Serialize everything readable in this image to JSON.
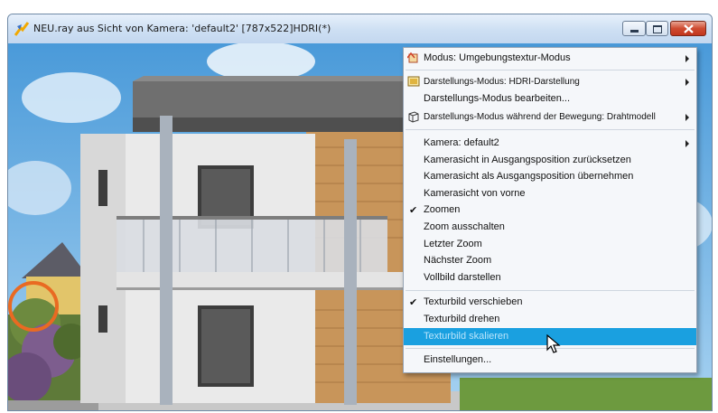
{
  "window": {
    "title": "NEU.ray aus Sicht von Kamera: 'default2' [787x522]HDRI(*)",
    "controls": [
      "minimize",
      "maximize",
      "close"
    ]
  },
  "context_menu": {
    "items": [
      {
        "label": "Modus:  Umgebungstextur-Modus",
        "icon": "texture-mode-icon",
        "submenu": true
      },
      {
        "label": "Darstellungs-Modus: HDRI-Darstellung",
        "icon": "render-mode-icon",
        "submenu": true
      },
      {
        "label": "Darstellungs-Modus bearbeiten...",
        "submenu": false
      },
      {
        "label": "Darstellungs-Modus während der Bewegung: Drahtmodell",
        "icon": "wireframe-icon",
        "submenu": true
      },
      {
        "label": "Kamera: default2",
        "submenu": true
      },
      {
        "label": "Kamerasicht in Ausgangsposition zurücksetzen"
      },
      {
        "label": "Kamerasicht als Ausgangsposition übernehmen"
      },
      {
        "label": "Kamerasicht von vorne"
      },
      {
        "label": "Zoomen",
        "checked": true
      },
      {
        "label": "Zoom ausschalten"
      },
      {
        "label": "Letzter Zoom"
      },
      {
        "label": "Nächster Zoom"
      },
      {
        "label": "Vollbild darstellen"
      },
      {
        "label": "Texturbild verschieben",
        "checked": true
      },
      {
        "label": "Texturbild drehen"
      },
      {
        "label": "Texturbild skalieren",
        "highlighted": true
      },
      {
        "label": "Einstellungen..."
      }
    ]
  },
  "colors": {
    "highlight_circle": "#e96a22",
    "menu_hover": "#1aa0e0",
    "close_button": "#c9452b"
  }
}
